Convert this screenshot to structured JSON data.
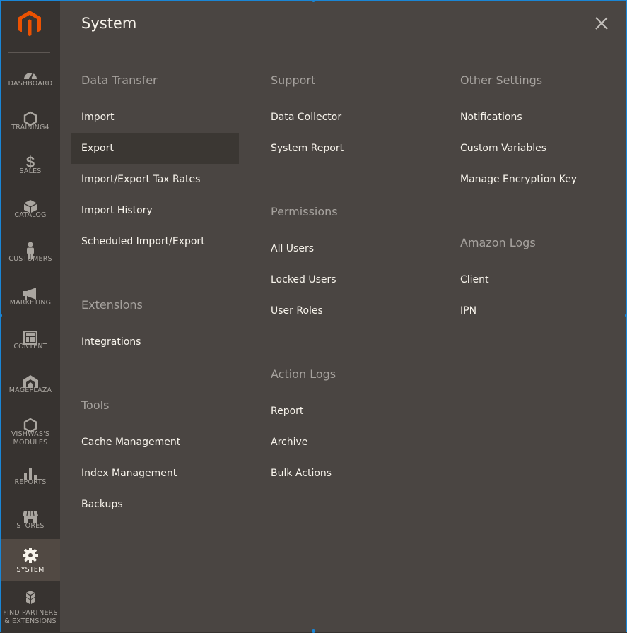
{
  "sidebar": {
    "logo": "magento-logo",
    "items": [
      {
        "label": "DASHBOARD",
        "icon": "dashboard-icon"
      },
      {
        "label": "TRAINING4",
        "icon": "hexagon-icon"
      },
      {
        "label": "SALES",
        "icon": "dollar-icon"
      },
      {
        "label": "CATALOG",
        "icon": "box-icon"
      },
      {
        "label": "CUSTOMERS",
        "icon": "person-icon"
      },
      {
        "label": "MARKETING",
        "icon": "megaphone-icon"
      },
      {
        "label": "CONTENT",
        "icon": "layout-icon"
      },
      {
        "label": "MAGEPLAZA",
        "icon": "mageplaza-icon"
      },
      {
        "label": "VISHWAS'S MODULES",
        "icon": "hexagon-icon"
      },
      {
        "label": "REPORTS",
        "icon": "bar-chart-icon"
      },
      {
        "label": "STORES",
        "icon": "store-icon"
      },
      {
        "label": "SYSTEM",
        "icon": "gear-icon",
        "active": true
      },
      {
        "label": "FIND PARTNERS & EXTENSIONS",
        "icon": "cubes-icon"
      }
    ]
  },
  "panel": {
    "title": "System",
    "close_icon": "close-icon",
    "columns": [
      {
        "sections": [
          {
            "title": "Data Transfer",
            "links": [
              "Import",
              "Export",
              "Import/Export Tax Rates",
              "Import History",
              "Scheduled Import/Export"
            ]
          },
          {
            "title": "Extensions",
            "links": [
              "Integrations"
            ]
          },
          {
            "title": "Tools",
            "links": [
              "Cache Management",
              "Index Management",
              "Backups"
            ]
          }
        ]
      },
      {
        "sections": [
          {
            "title": "Support",
            "links": [
              "Data Collector",
              "System Report"
            ]
          },
          {
            "title": "Permissions",
            "links": [
              "All Users",
              "Locked Users",
              "User Roles"
            ]
          },
          {
            "title": "Action Logs",
            "links": [
              "Report",
              "Archive",
              "Bulk Actions"
            ]
          }
        ]
      },
      {
        "sections": [
          {
            "title": "Other Settings",
            "links": [
              "Notifications",
              "Custom Variables",
              "Manage Encryption Key"
            ]
          },
          {
            "title": "Amazon Logs",
            "links": [
              "Client",
              "IPN"
            ]
          }
        ]
      }
    ],
    "hovered_link": "Export"
  },
  "colors": {
    "sidebar_bg": "#373330",
    "panel_bg": "#4a4542",
    "active_item_bg": "#514943",
    "hover_bg": "#3b3733",
    "logo_orange": "#eb5202",
    "section_title": "#a6a29e",
    "link_text": "#f7f3eb"
  }
}
